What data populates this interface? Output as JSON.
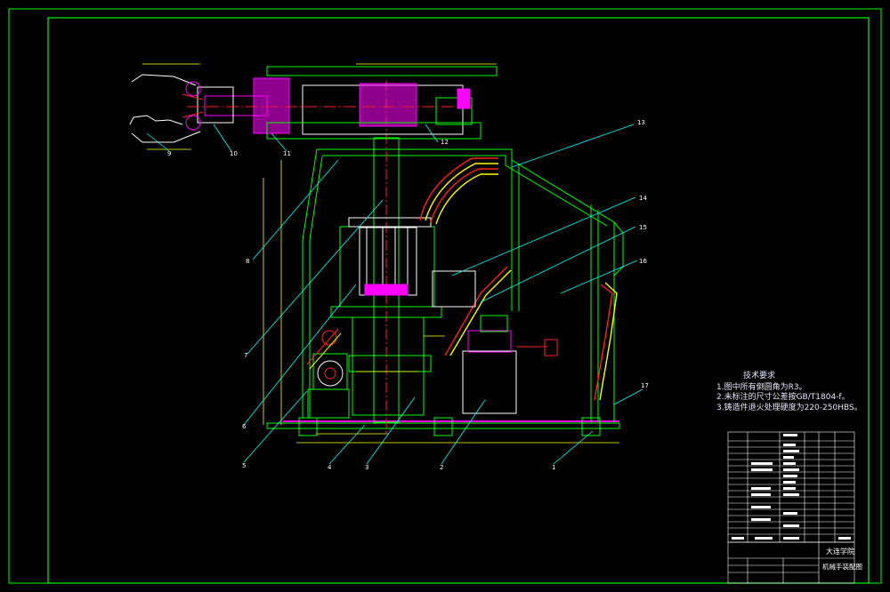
{
  "notes": {
    "heading": "技术要求",
    "items": [
      "1.图中所有倒圆角为R3。",
      "2.未标注的尺寸公差按GB/T1804-f。",
      "3.铸造件退火处理硬度为220-250HBS。"
    ]
  },
  "title_block": {
    "school": "大连学院",
    "drawing_name": "机械手装配图"
  },
  "callouts": [
    "1",
    "2",
    "3",
    "4",
    "5",
    "6",
    "7",
    "8",
    "9",
    "10",
    "11",
    "12",
    "13",
    "14",
    "15",
    "16",
    "17"
  ],
  "colors": {
    "frame": "#00ff00",
    "dimension": "#ffff00",
    "section": "#ff00ff",
    "red": "#ff2020",
    "white": "#ffffff",
    "cyan": "#00ffff"
  }
}
